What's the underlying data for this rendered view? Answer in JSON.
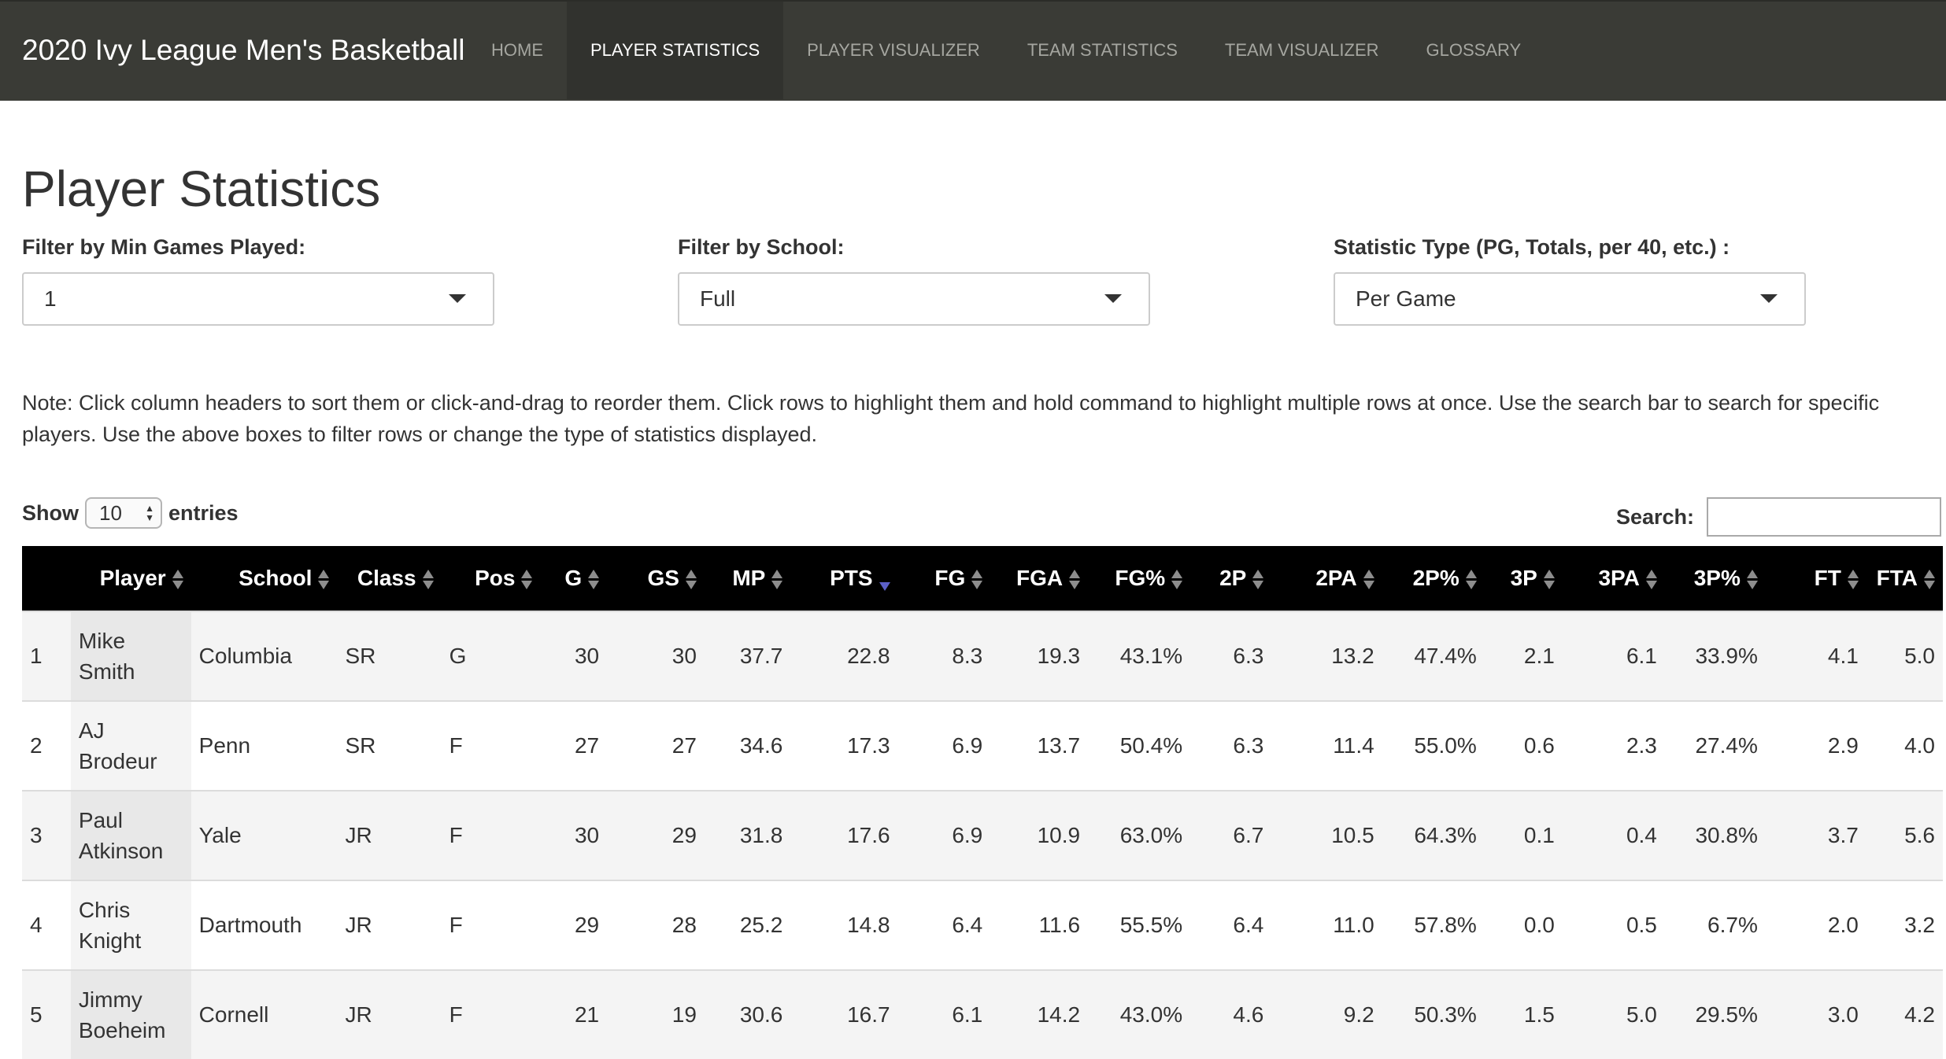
{
  "navbar": {
    "brand": "2020 Ivy League Men's Basketball",
    "items": [
      {
        "label": "HOME",
        "active": false
      },
      {
        "label": "PLAYER STATISTICS",
        "active": true
      },
      {
        "label": "PLAYER VISUALIZER",
        "active": false
      },
      {
        "label": "TEAM STATISTICS",
        "active": false
      },
      {
        "label": "TEAM VISUALIZER",
        "active": false
      },
      {
        "label": "GLOSSARY",
        "active": false
      }
    ]
  },
  "page": {
    "title": "Player Statistics",
    "note": "Note: Click column headers to sort them or click-and-drag to reorder them. Click rows to highlight them and hold command to highlight multiple rows at once. Use the search bar to search for specific players. Use the above boxes to filter rows or change the type of statistics displayed."
  },
  "filters": {
    "min_games": {
      "label": "Filter by Min Games Played:",
      "value": "1"
    },
    "school": {
      "label": "Filter by School:",
      "value": "Full"
    },
    "stat_type": {
      "label": "Statistic Type (PG, Totals, per 40, etc.) :",
      "value": "Per Game"
    }
  },
  "table_controls": {
    "show_label": "Show",
    "entries_value": "10",
    "entries_label": "entries",
    "search_label": "Search:",
    "search_value": ""
  },
  "table": {
    "sorted_column": "PTS",
    "sort_direction": "desc",
    "columns": [
      "",
      "Player",
      "School",
      "Class",
      "Pos",
      "G",
      "GS",
      "MP",
      "PTS",
      "FG",
      "FGA",
      "FG%",
      "2P",
      "2PA",
      "2P%",
      "3P",
      "3PA",
      "3P%",
      "FT",
      "FTA"
    ],
    "rows": [
      [
        "1",
        "Mike Smith",
        "Columbia",
        "SR",
        "G",
        "30",
        "30",
        "37.7",
        "22.8",
        "8.3",
        "19.3",
        "43.1%",
        "6.3",
        "13.2",
        "47.4%",
        "2.1",
        "6.1",
        "33.9%",
        "4.1",
        "5.0"
      ],
      [
        "2",
        "AJ Brodeur",
        "Penn",
        "SR",
        "F",
        "27",
        "27",
        "34.6",
        "17.3",
        "6.9",
        "13.7",
        "50.4%",
        "6.3",
        "11.4",
        "55.0%",
        "0.6",
        "2.3",
        "27.4%",
        "2.9",
        "4.0"
      ],
      [
        "3",
        "Paul Atkinson",
        "Yale",
        "JR",
        "F",
        "30",
        "29",
        "31.8",
        "17.6",
        "6.9",
        "10.9",
        "63.0%",
        "6.7",
        "10.5",
        "64.3%",
        "0.1",
        "0.4",
        "30.8%",
        "3.7",
        "5.6"
      ],
      [
        "4",
        "Chris Knight",
        "Dartmouth",
        "JR",
        "F",
        "29",
        "28",
        "25.2",
        "14.8",
        "6.4",
        "11.6",
        "55.5%",
        "6.4",
        "11.0",
        "57.8%",
        "0.0",
        "0.5",
        "6.7%",
        "2.0",
        "3.2"
      ],
      [
        "5",
        "Jimmy Boeheim",
        "Cornell",
        "JR",
        "F",
        "21",
        "19",
        "30.6",
        "16.7",
        "6.1",
        "14.2",
        "43.0%",
        "4.6",
        "9.2",
        "50.3%",
        "1.5",
        "5.0",
        "29.5%",
        "3.0",
        "4.2"
      ]
    ]
  }
}
